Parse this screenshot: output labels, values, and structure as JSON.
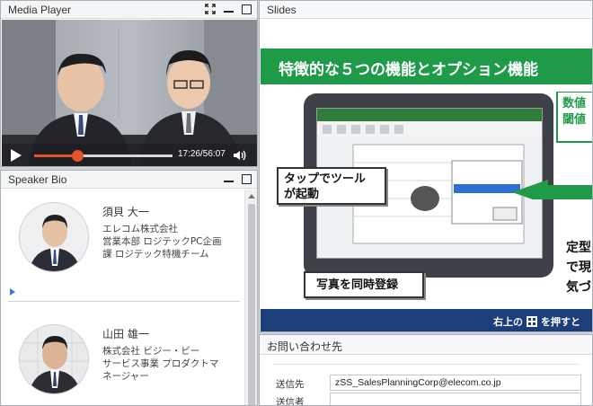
{
  "media_player": {
    "title": "Media Player",
    "time": "17:26/56:07",
    "progress_fraction": 0.31,
    "icons": [
      "fullscreen-icon",
      "minimize-icon",
      "maximize-icon",
      "play-icon",
      "volume-icon"
    ]
  },
  "speaker_bio": {
    "title": "Speaker Bio",
    "speakers": [
      {
        "name": "須貝 大一",
        "lines": [
          "エレコム株式会社",
          "営業本部 ロジテックPC企画",
          "課 ロジテック特機チーム"
        ]
      },
      {
        "name": "山田 雄一",
        "lines": [
          "株式会社 ビジー・ビー",
          "サービス事業 プロダクトマ",
          "ネージャー"
        ]
      }
    ]
  },
  "slides": {
    "title": "Slides",
    "slide_title": "特徴的な５つの機能とオプション機能",
    "callout_tap": [
      "タップでツール",
      "が起動"
    ],
    "callout_photo": "写真を同時登録",
    "side_text": [
      "定型",
      "で現",
      "気づ"
    ],
    "right_panel_text": [
      "数値",
      "閾値"
    ],
    "bottom_text_pre": "右上の",
    "bottom_text_post": "を押すと",
    "colors": {
      "band": "#1e9a48",
      "bottom_band": "#1c3f7a"
    }
  },
  "contact": {
    "title": "お問い合わせ先",
    "fields": [
      {
        "label": "送信先",
        "value": "zSS_SalesPlanningCorp@elecom.co.jp"
      },
      {
        "label": "送信者",
        "value": ""
      }
    ]
  }
}
